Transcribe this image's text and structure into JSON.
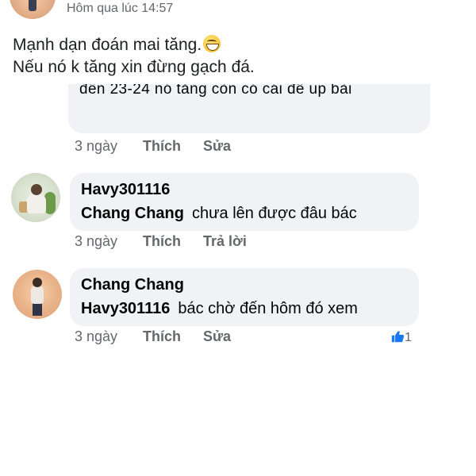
{
  "post": {
    "timestamp": "Hôm qua lúc 14:57",
    "text_line1": "Mạnh dạn đoán mai tăng.",
    "text_line2": "Nếu nó k tăng xin đừng gạch đá.",
    "emoji": "grinning-face-emoji"
  },
  "comments": [
    {
      "partial_text": "đến 23-24 nó tăng còn có cái để up bài",
      "actions": {
        "time": "3 ngày",
        "like": "Thích",
        "second": "Sửa"
      }
    },
    {
      "author": "Havy301116",
      "mention": "Chang Chang",
      "text": "chưa lên được đâu bác",
      "avatar": "child-photo-avatar",
      "actions": {
        "time": "3 ngày",
        "like": "Thích",
        "second": "Trả lời"
      }
    },
    {
      "author": "Chang Chang",
      "mention": "Havy301116",
      "text": "bác chờ đến hôm đó xem",
      "avatar": "person-photo-avatar",
      "actions": {
        "time": "3 ngày",
        "like": "Thích",
        "second": "Sửa"
      },
      "reactions": {
        "icon": "thumbs-up-icon",
        "count": "1",
        "color": "#1877f2"
      }
    }
  ]
}
